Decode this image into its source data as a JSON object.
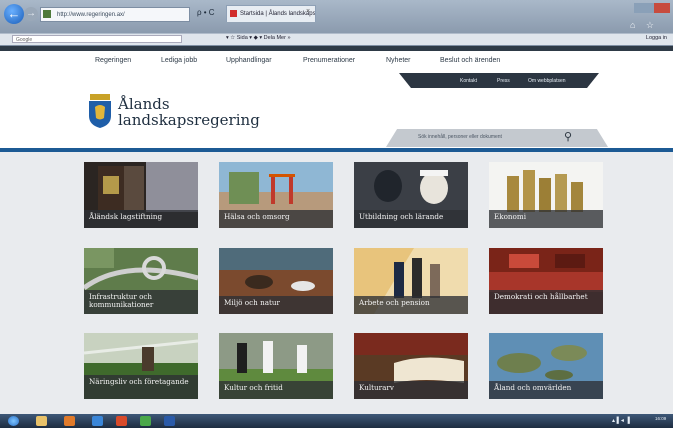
{
  "browser": {
    "url": "http://www.regeringen.ax/",
    "search_controls": "ρ • C",
    "tab_title": "Startsida | Ålands landskaps...",
    "tab_close": "×",
    "back_icon": "←",
    "forward_icon": "→",
    "home_icons": "⌂ ☆",
    "google_field": "Google",
    "toolbar_mid": "▾ ☆ Sida ▾ ◆ ▾ Dela  Mer »",
    "login": "Logga in"
  },
  "nav": {
    "items": [
      "Regeringen",
      "Lediga jobb",
      "Upphandlingar",
      "Prenumerationer",
      "Nyheter",
      "Beslut och ärenden"
    ]
  },
  "subnav": {
    "items": [
      "Kontakt",
      "Press",
      "Om webbplatsen"
    ]
  },
  "logo": {
    "line1": "Ålands",
    "line2": "landskapsregering"
  },
  "search": {
    "placeholder": "Sök innehåll, personer eller dokument",
    "icon": "search-icon"
  },
  "colors": {
    "dark_header": "#2e3a46",
    "accent_blue": "#1c5a94",
    "caption_bg": "#2d3034"
  },
  "tiles": [
    {
      "label": "Åländsk lagstiftning"
    },
    {
      "label": "Hälsa och omsorg"
    },
    {
      "label": "Utbildning och lärande"
    },
    {
      "label": "Ekonomi"
    },
    {
      "label": "Infrastruktur och kommunikationer"
    },
    {
      "label": "Miljö och natur"
    },
    {
      "label": "Arbete och pension"
    },
    {
      "label": "Demokrati och hållbarhet"
    },
    {
      "label": "Näringsliv och företagande"
    },
    {
      "label": "Kultur och fritid"
    },
    {
      "label": "Kulturarv"
    },
    {
      "label": "Åland och omvärlden"
    }
  ],
  "taskbar": {
    "tray": "▴ ▌◂ ▐",
    "clock": "16:09"
  }
}
